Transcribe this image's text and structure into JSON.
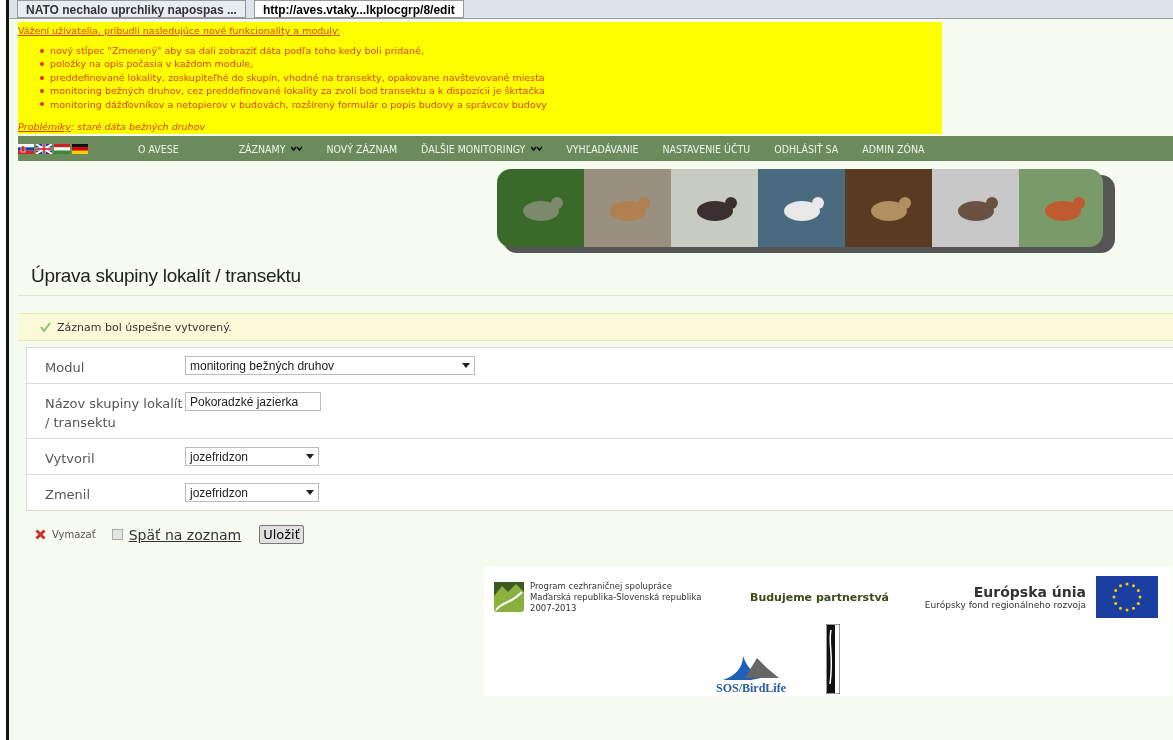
{
  "browser_tabs": [
    {
      "title": "NATO nechalo uprchliky napospas ...",
      "selected": false
    },
    {
      "title": "http://aves.vtaky...lkplocgrp/8/edit",
      "selected": true
    }
  ],
  "notice": {
    "heading": "Vážení užívatelia, pribudli nasledujúce nové funkcionality a moduly:",
    "items": [
      "nový stĺpec \"Zmenený\" aby sa dali zobraziť dáta podľa toho kedy boli pridané,",
      "položky na opis počasia v každom module,",
      "preddefinované lokality, zoskupiteľhé do skupín, vhodné na transekty, opakovane navštevované miesta",
      "monitoring bežných druhov, cez preddefinované lokality za zvolí bod transektu a k dispozícii je škrtačka",
      "monitoring dážďovníkov a netopierov v budovách, rozšírený formulár o popis budovy a správcov budovy"
    ],
    "problems_link": "Problémiky",
    "problems_text": ": staré dáta bežných druhov"
  },
  "nav": {
    "items": [
      {
        "label": "O AVESE",
        "dropdown": false
      },
      {
        "label": "ZÁZNAMY",
        "dropdown": true
      },
      {
        "label": "NOVÝ ZÁZNAM",
        "dropdown": false
      },
      {
        "label": "ĎALŠIE MONITORINGY",
        "dropdown": true
      },
      {
        "label": "VYHĽADÁVANIE",
        "dropdown": false
      },
      {
        "label": "NASTAVENIE ÚČTU",
        "dropdown": false
      },
      {
        "label": "ODHLÁSIŤ SA",
        "dropdown": false
      },
      {
        "label": "ADMIN ZÓNA",
        "dropdown": false
      }
    ]
  },
  "page_title": "Úprava skupiny lokalít / transektu",
  "flash_message": "Záznam bol úspešne vytvorený.",
  "form": [
    {
      "label": "Modul",
      "kind": "select",
      "value": "monitoring bežných druhov"
    },
    {
      "label": "Názov skupiny lokalít / transektu",
      "kind": "text",
      "value": "Pokoradzké jazierka"
    },
    {
      "label": "Vytvoril",
      "kind": "select",
      "value": "jozefridzon"
    },
    {
      "label": "Zmenil",
      "kind": "select",
      "value": "jozefridzon"
    }
  ],
  "actions": {
    "delete": "Vymazať",
    "back": "Späť na zoznam",
    "save": "Uložiť"
  },
  "footer": {
    "program_lines": [
      "Program cezhraničnej spolupráce",
      "Maďarská republika-Slovenská republika",
      "2007-2013"
    ],
    "slogan": "Budujeme partnerstvá",
    "eu_title": "Európska únia",
    "eu_subtitle": "Európsky fond regionálneho rozvoja",
    "partner": "SOS/BirdLife"
  }
}
